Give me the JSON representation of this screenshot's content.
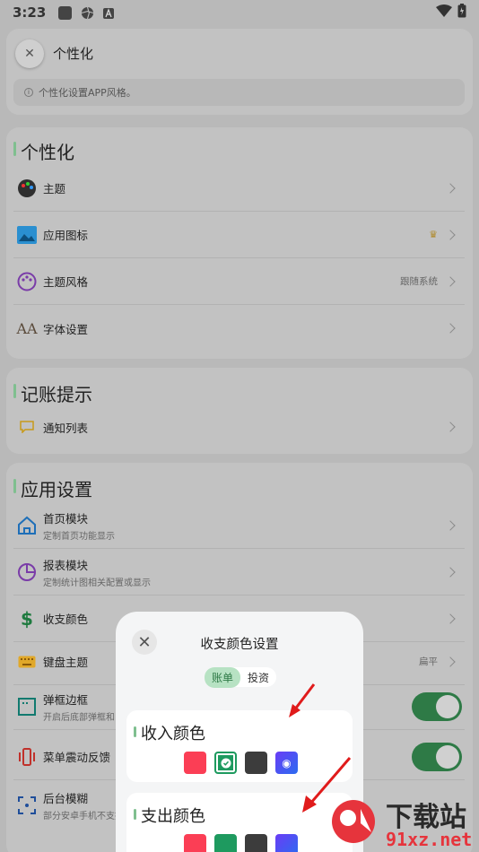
{
  "status": {
    "time": "3:23"
  },
  "header": {
    "title": "个性化",
    "info": "个性化设置APP风格。"
  },
  "sections": {
    "personal": {
      "title": "个性化",
      "theme": "主题",
      "app_icon": "应用图标",
      "theme_style": "主题风格",
      "theme_style_value": "跟随系统",
      "font": "字体设置"
    },
    "reminder": {
      "title": "记账提示",
      "notify": "通知列表"
    },
    "app": {
      "title": "应用设置",
      "home": "首页模块",
      "home_sub": "定制首页功能显示",
      "report": "报表模块",
      "report_sub": "定制统计图相关配置或显示",
      "colors": "收支颜色",
      "keyboard": "键盘主题",
      "keyboard_value": "扁平",
      "border": "弹框边框",
      "border_sub": "开启后底部弹框和",
      "vibrate": "菜单震动反馈",
      "blur": "后台模糊",
      "blur_sub": "部分安卓手机不支持"
    }
  },
  "sheet": {
    "title": "收支颜色设置",
    "tabs": [
      "账单",
      "投资"
    ],
    "income_title": "收入颜色",
    "expense_title": "支出颜色"
  },
  "watermark": {
    "brand": "下载站",
    "url": "91xz.net"
  },
  "colors": {
    "red": "#fb3e55",
    "green": "#1e9a5f",
    "dark": "#3c3c3c",
    "blue": "#5b4af2",
    "toggle": "#2e7a46"
  }
}
